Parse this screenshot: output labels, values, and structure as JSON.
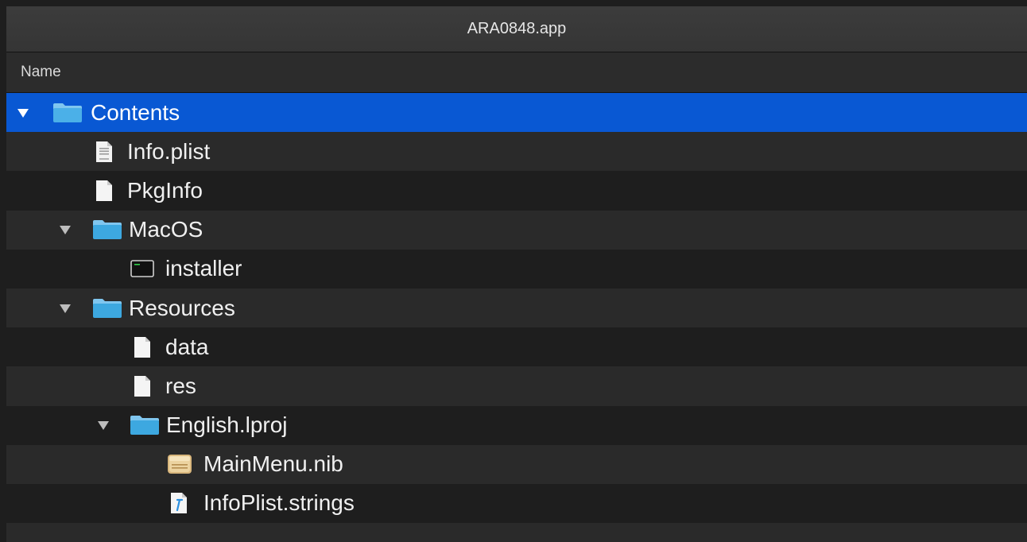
{
  "window": {
    "title": "ARA0848.app"
  },
  "header": {
    "name_column": "Name"
  },
  "rows": [
    {
      "label": "Contents",
      "icon": "folder-icon",
      "expanded": true,
      "selected": true
    },
    {
      "label": "Info.plist",
      "icon": "plist-file-icon"
    },
    {
      "label": "PkgInfo",
      "icon": "document-icon"
    },
    {
      "label": "MacOS",
      "icon": "folder-icon",
      "expanded": true
    },
    {
      "label": "installer",
      "icon": "terminal-executable-icon"
    },
    {
      "label": "Resources",
      "icon": "folder-icon",
      "expanded": true
    },
    {
      "label": "data",
      "icon": "document-icon"
    },
    {
      "label": "res",
      "icon": "document-icon"
    },
    {
      "label": "English.lproj",
      "icon": "folder-icon",
      "expanded": true
    },
    {
      "label": "MainMenu.nib",
      "icon": "nib-file-icon"
    },
    {
      "label": "InfoPlist.strings",
      "icon": "strings-file-icon"
    }
  ],
  "colors": {
    "selection": "#0958d3",
    "folder": "#3da8e0"
  }
}
